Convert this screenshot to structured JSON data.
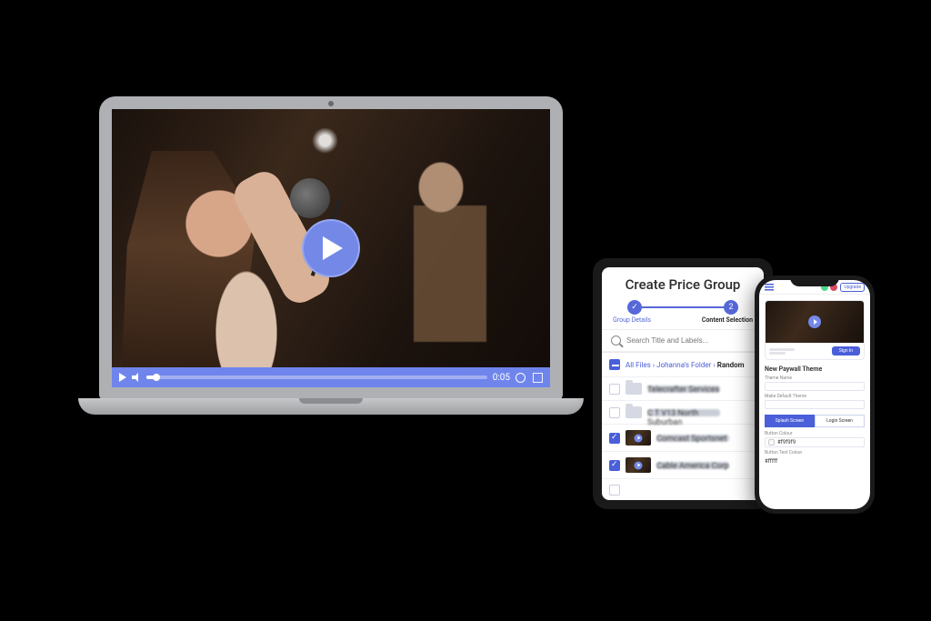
{
  "video": {
    "time": "0:05"
  },
  "tablet": {
    "title": "Create Price Group",
    "step1": "Group Details",
    "step2": "Content Selection",
    "search_placeholder": "Search Title and Labels...",
    "breadcrumb_all": "All Files",
    "breadcrumb_folder": "Johanna's Folder",
    "breadcrumb_last": "Random",
    "rows": [
      {
        "label": "Telecrafter Services"
      },
      {
        "label": "C T V13 North Suburban"
      },
      {
        "label": "Comcast Sportsnet"
      },
      {
        "label": "Cable America Corp"
      }
    ]
  },
  "phone": {
    "upgrade": "Upgrade",
    "card_button": "Sign In",
    "section_title": "New Paywall Theme",
    "field_theme_label": "Theme Name",
    "field_default_label": "Make Default Theme",
    "tab_splash": "Splash Screen",
    "tab_login": "Login Screen",
    "button_colour_label": "Button Colour",
    "button_colour_value": "#f9f9f9",
    "button_text_colour_label": "Button Text Colour",
    "button_text_colour_value": "#fffff"
  },
  "colors": {
    "accent": "#4a5fd9",
    "play": "#7488e8"
  }
}
